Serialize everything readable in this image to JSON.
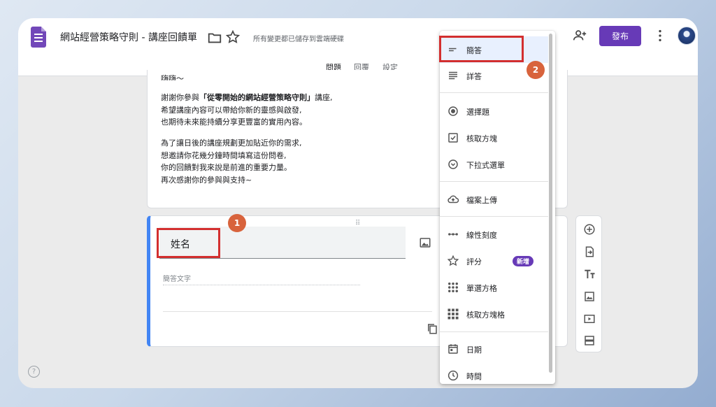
{
  "header": {
    "doc_title": "網站經營策略守則 - 講座回饋單",
    "saved_status": "所有變更都已儲存到雲端硬碟",
    "publish_label": "發布"
  },
  "tabs": [
    {
      "label": "問題"
    },
    {
      "label": "回覆"
    },
    {
      "label": "設定"
    }
  ],
  "description": {
    "line_top": "嗨嗨～",
    "p1_prefix": "謝謝你參與",
    "p1_bold": "「從零開始的網站經營策略守則」",
    "p1_suffix": "講座,",
    "p1_l2": "希望講座內容可以帶給你新的靈感與啟發,",
    "p1_l3": "也期待未來能持續分享更豐富的實用內容。",
    "p2_l1": "為了讓日後的講座規劃更加貼近你的需求,",
    "p2_l2": "想邀請你花幾分鐘時間填寫這份問卷,",
    "p2_l3": "你的回饋對我來說是前進的重要力量。",
    "p2_l4": "再次感謝你的參與與支持~"
  },
  "question": {
    "title": "姓名",
    "answer_hint": "簡答文字"
  },
  "annotations": {
    "marker1": "1",
    "marker2": "2"
  },
  "type_menu": {
    "items": [
      {
        "label": "簡答",
        "icon": "short-answer-icon",
        "selected": true
      },
      {
        "label": "詳答",
        "icon": "paragraph-icon"
      },
      {
        "label": "選擇題",
        "icon": "radio-icon"
      },
      {
        "label": "核取方塊",
        "icon": "checkbox-icon"
      },
      {
        "label": "下拉式選單",
        "icon": "dropdown-icon"
      },
      {
        "label": "檔案上傳",
        "icon": "cloud-upload-icon"
      },
      {
        "label": "線性刻度",
        "icon": "linear-scale-icon"
      },
      {
        "label": "評分",
        "icon": "star-icon",
        "badge": "新增"
      },
      {
        "label": "單選方格",
        "icon": "grid-icon"
      },
      {
        "label": "核取方塊格",
        "icon": "checkbox-grid-icon"
      },
      {
        "label": "日期",
        "icon": "calendar-icon"
      },
      {
        "label": "時間",
        "icon": "clock-icon"
      }
    ]
  },
  "colors": {
    "accent": "#673ab7",
    "question_border": "#4285f4",
    "highlight_frame": "#d32f2f",
    "marker": "#d8633c"
  }
}
